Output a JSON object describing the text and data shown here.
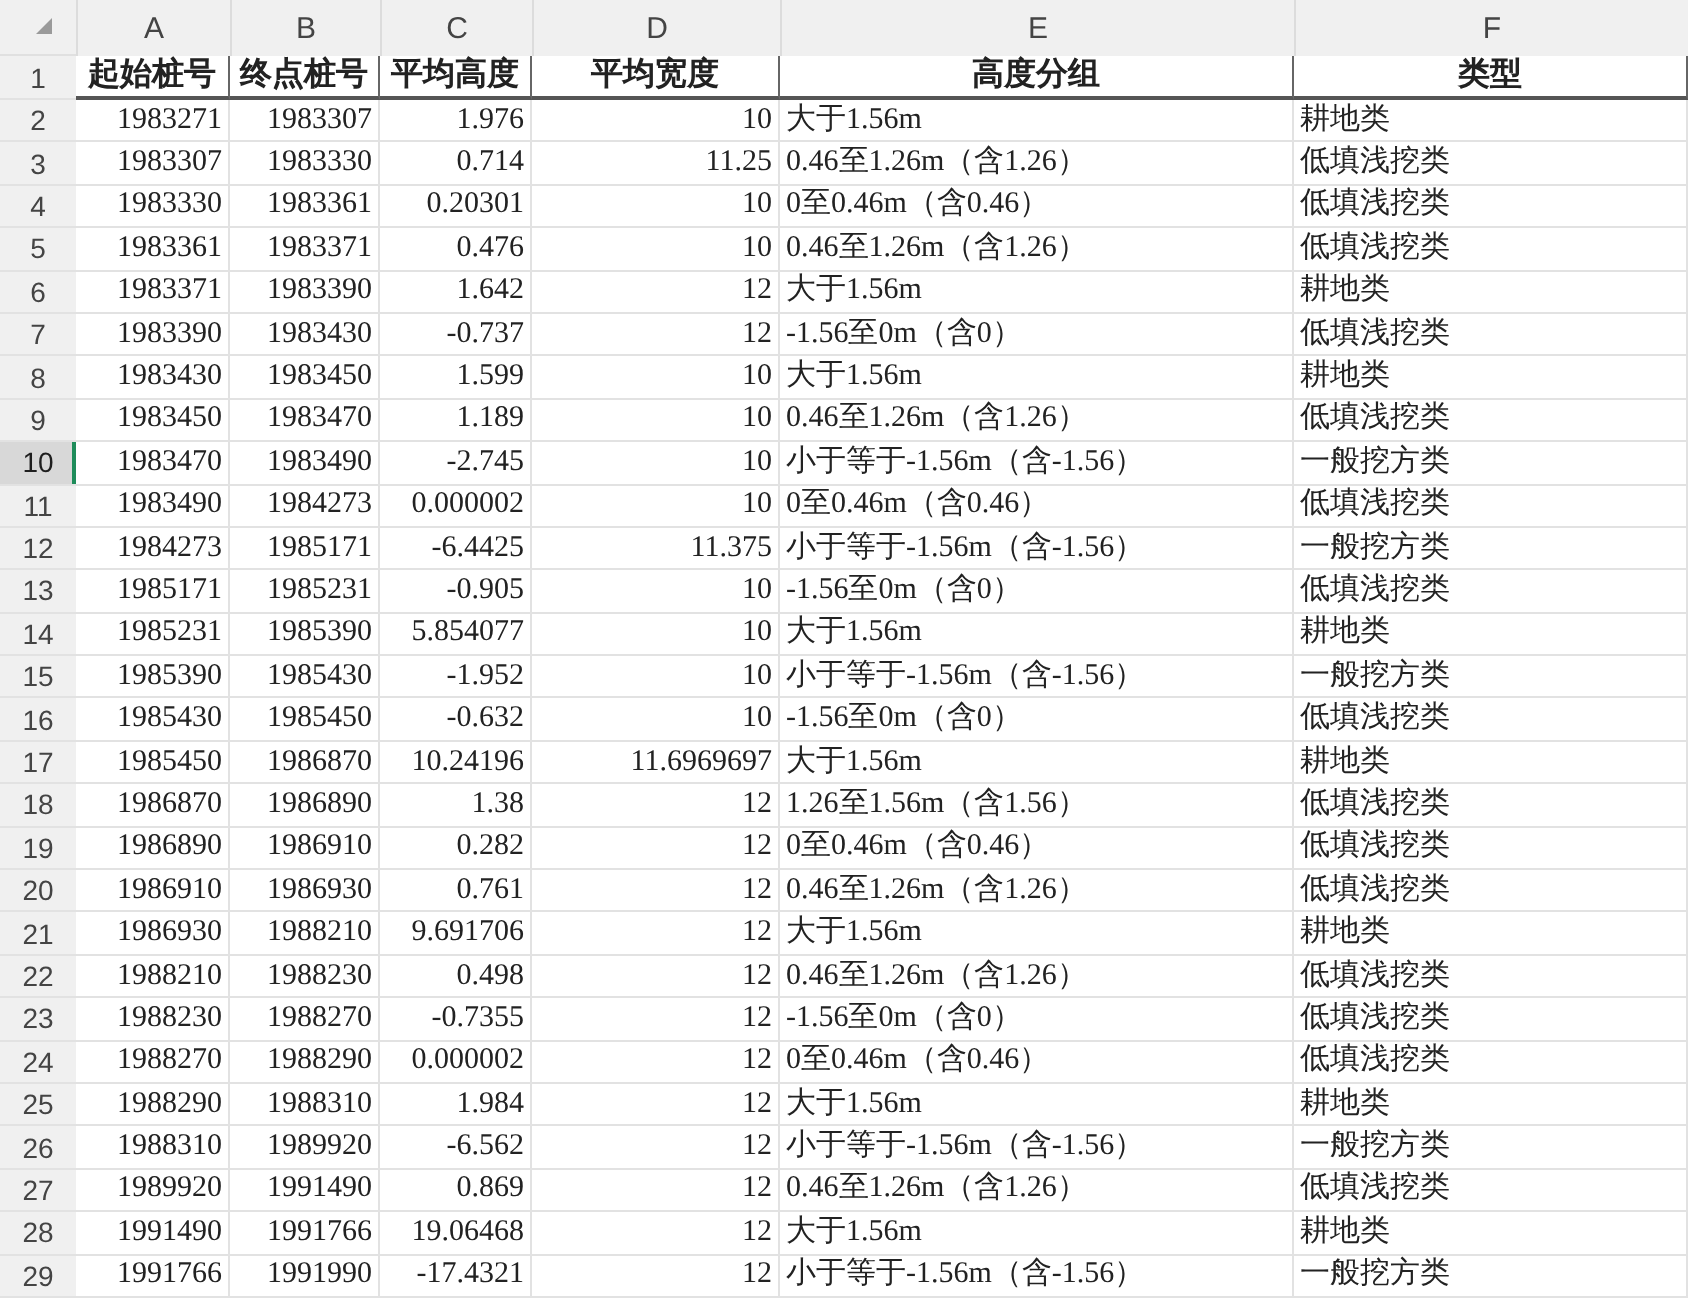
{
  "columns": [
    {
      "letter": "A"
    },
    {
      "letter": "B"
    },
    {
      "letter": "C"
    },
    {
      "letter": "D"
    },
    {
      "letter": "E"
    },
    {
      "letter": "F"
    }
  ],
  "rows": [
    {
      "number": "1",
      "selected": false,
      "kind": "header",
      "cells": [
        "起始桩号",
        "终点桩号",
        "平均高度",
        "平均宽度",
        "高度分组",
        "类型"
      ]
    },
    {
      "number": "2",
      "selected": false,
      "kind": "data",
      "cells": [
        "1983271",
        "1983307",
        "1.976",
        "10",
        "大于1.56m",
        "耕地类"
      ]
    },
    {
      "number": "3",
      "selected": false,
      "kind": "data",
      "cells": [
        "1983307",
        "1983330",
        "0.714",
        "11.25",
        "0.46至1.26m（含1.26）",
        "低填浅挖类"
      ]
    },
    {
      "number": "4",
      "selected": false,
      "kind": "data",
      "cells": [
        "1983330",
        "1983361",
        "0.20301",
        "10",
        "0至0.46m（含0.46）",
        "低填浅挖类"
      ]
    },
    {
      "number": "5",
      "selected": false,
      "kind": "data",
      "cells": [
        "1983361",
        "1983371",
        "0.476",
        "10",
        "0.46至1.26m（含1.26）",
        "低填浅挖类"
      ]
    },
    {
      "number": "6",
      "selected": false,
      "kind": "data",
      "cells": [
        "1983371",
        "1983390",
        "1.642",
        "12",
        "大于1.56m",
        "耕地类"
      ]
    },
    {
      "number": "7",
      "selected": false,
      "kind": "data",
      "cells": [
        "1983390",
        "1983430",
        "-0.737",
        "12",
        "-1.56至0m（含0）",
        "低填浅挖类"
      ]
    },
    {
      "number": "8",
      "selected": false,
      "kind": "data",
      "cells": [
        "1983430",
        "1983450",
        "1.599",
        "10",
        "大于1.56m",
        "耕地类"
      ]
    },
    {
      "number": "9",
      "selected": false,
      "kind": "data",
      "cells": [
        "1983450",
        "1983470",
        "1.189",
        "10",
        "0.46至1.26m（含1.26）",
        "低填浅挖类"
      ]
    },
    {
      "number": "10",
      "selected": true,
      "kind": "data",
      "cells": [
        "1983470",
        "1983490",
        "-2.745",
        "10",
        "小于等于-1.56m（含-1.56）",
        "一般挖方类"
      ]
    },
    {
      "number": "11",
      "selected": false,
      "kind": "data",
      "cells": [
        "1983490",
        "1984273",
        "0.000002",
        "10",
        "0至0.46m（含0.46）",
        "低填浅挖类"
      ]
    },
    {
      "number": "12",
      "selected": false,
      "kind": "data",
      "cells": [
        "1984273",
        "1985171",
        "-6.4425",
        "11.375",
        "小于等于-1.56m（含-1.56）",
        "一般挖方类"
      ]
    },
    {
      "number": "13",
      "selected": false,
      "kind": "data",
      "cells": [
        "1985171",
        "1985231",
        "-0.905",
        "10",
        "-1.56至0m（含0）",
        "低填浅挖类"
      ]
    },
    {
      "number": "14",
      "selected": false,
      "kind": "data",
      "cells": [
        "1985231",
        "1985390",
        "5.854077",
        "10",
        "大于1.56m",
        "耕地类"
      ]
    },
    {
      "number": "15",
      "selected": false,
      "kind": "data",
      "cells": [
        "1985390",
        "1985430",
        "-1.952",
        "10",
        "小于等于-1.56m（含-1.56）",
        "一般挖方类"
      ]
    },
    {
      "number": "16",
      "selected": false,
      "kind": "data",
      "cells": [
        "1985430",
        "1985450",
        "-0.632",
        "10",
        "-1.56至0m（含0）",
        "低填浅挖类"
      ]
    },
    {
      "number": "17",
      "selected": false,
      "kind": "data",
      "cells": [
        "1985450",
        "1986870",
        "10.24196",
        "11.6969697",
        "大于1.56m",
        "耕地类"
      ]
    },
    {
      "number": "18",
      "selected": false,
      "kind": "data",
      "cells": [
        "1986870",
        "1986890",
        "1.38",
        "12",
        "1.26至1.56m（含1.56）",
        "低填浅挖类"
      ]
    },
    {
      "number": "19",
      "selected": false,
      "kind": "data",
      "cells": [
        "1986890",
        "1986910",
        "0.282",
        "12",
        "0至0.46m（含0.46）",
        "低填浅挖类"
      ]
    },
    {
      "number": "20",
      "selected": false,
      "kind": "data",
      "cells": [
        "1986910",
        "1986930",
        "0.761",
        "12",
        "0.46至1.26m（含1.26）",
        "低填浅挖类"
      ]
    },
    {
      "number": "21",
      "selected": false,
      "kind": "data",
      "cells": [
        "1986930",
        "1988210",
        "9.691706",
        "12",
        "大于1.56m",
        "耕地类"
      ]
    },
    {
      "number": "22",
      "selected": false,
      "kind": "data",
      "cells": [
        "1988210",
        "1988230",
        "0.498",
        "12",
        "0.46至1.26m（含1.26）",
        "低填浅挖类"
      ]
    },
    {
      "number": "23",
      "selected": false,
      "kind": "data",
      "cells": [
        "1988230",
        "1988270",
        "-0.7355",
        "12",
        "-1.56至0m（含0）",
        "低填浅挖类"
      ]
    },
    {
      "number": "24",
      "selected": false,
      "kind": "data",
      "cells": [
        "1988270",
        "1988290",
        "0.000002",
        "12",
        "0至0.46m（含0.46）",
        "低填浅挖类"
      ]
    },
    {
      "number": "25",
      "selected": false,
      "kind": "data",
      "cells": [
        "1988290",
        "1988310",
        "1.984",
        "12",
        "大于1.56m",
        "耕地类"
      ]
    },
    {
      "number": "26",
      "selected": false,
      "kind": "data",
      "cells": [
        "1988310",
        "1989920",
        "-6.562",
        "12",
        "小于等于-1.56m（含-1.56）",
        "一般挖方类"
      ]
    },
    {
      "number": "27",
      "selected": false,
      "kind": "data",
      "cells": [
        "1989920",
        "1991490",
        "0.869",
        "12",
        "0.46至1.26m（含1.26）",
        "低填浅挖类"
      ]
    },
    {
      "number": "28",
      "selected": false,
      "kind": "data",
      "cells": [
        "1991490",
        "1991766",
        "19.06468",
        "12",
        "大于1.56m",
        "耕地类"
      ]
    },
    {
      "number": "29",
      "selected": false,
      "kind": "data",
      "cells": [
        "1991766",
        "1991990",
        "-17.4321",
        "12",
        "小于等于-1.56m（含-1.56）",
        "一般挖方类"
      ]
    }
  ]
}
